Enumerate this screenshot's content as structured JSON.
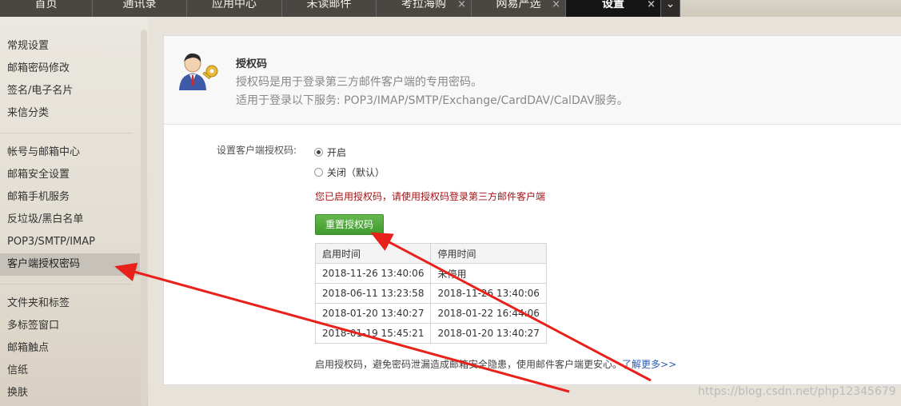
{
  "top_tabs": [
    {
      "label": "首页",
      "closable": false,
      "active": false
    },
    {
      "label": "通讯录",
      "closable": false,
      "active": false
    },
    {
      "label": "应用中心",
      "closable": false,
      "active": false
    },
    {
      "label": "未读邮件",
      "closable": false,
      "active": false
    },
    {
      "label": "考拉海购",
      "closable": true,
      "active": false
    },
    {
      "label": "网易严选",
      "closable": true,
      "active": false
    },
    {
      "label": "设置",
      "closable": true,
      "active": true
    }
  ],
  "close_glyph": "×",
  "more_glyph": "⌄",
  "sidebar": {
    "group1": [
      "常规设置",
      "邮箱密码修改",
      "签名/电子名片",
      "来信分类"
    ],
    "group2": [
      "帐号与邮箱中心",
      "邮箱安全设置",
      "邮箱手机服务",
      "反垃圾/黑白名单",
      "POP3/SMTP/IMAP",
      "客户端授权密码"
    ],
    "group3": [
      "文件夹和标签",
      "多标签窗口",
      "邮箱触点",
      "信纸",
      "换肤"
    ],
    "active_item": "客户端授权密码"
  },
  "header": {
    "title": "授权码",
    "desc": "授权码是用于登录第三方邮件客户端的专用密码。",
    "desc2": "适用于登录以下服务: POP3/IMAP/SMTP/Exchange/CardDAV/CalDAV服务。"
  },
  "setting": {
    "label": "设置客户端授权码:",
    "options": [
      {
        "label": "开启",
        "selected": true
      },
      {
        "label": "关闭（默认）",
        "selected": false
      }
    ],
    "notice": "您已启用授权码，请使用授权码登录第三方邮件客户端",
    "reset_button": "重置授权码"
  },
  "history": {
    "columns": [
      "启用时间",
      "停用时间"
    ],
    "rows": [
      [
        "2018-11-26 13:40:06",
        "未停用"
      ],
      [
        "2018-06-11 13:23:58",
        "2018-11-26 13:40:06"
      ],
      [
        "2018-01-20 13:40:27",
        "2018-01-22 16:44:06"
      ],
      [
        "2018-01-19 15:45:21",
        "2018-01-20 13:40:27"
      ]
    ]
  },
  "footnote": {
    "text": "启用授权码，避免密码泄漏造成邮箱安全隐患，使用邮件客户端更安心。",
    "link": "了解更多>>"
  },
  "watermark": "https://blog.csdn.net/php12345679",
  "colors": {
    "notice": "#a41416",
    "button": "#4ca93a",
    "arrow": "#e8211a",
    "link": "#2b5bb8"
  }
}
